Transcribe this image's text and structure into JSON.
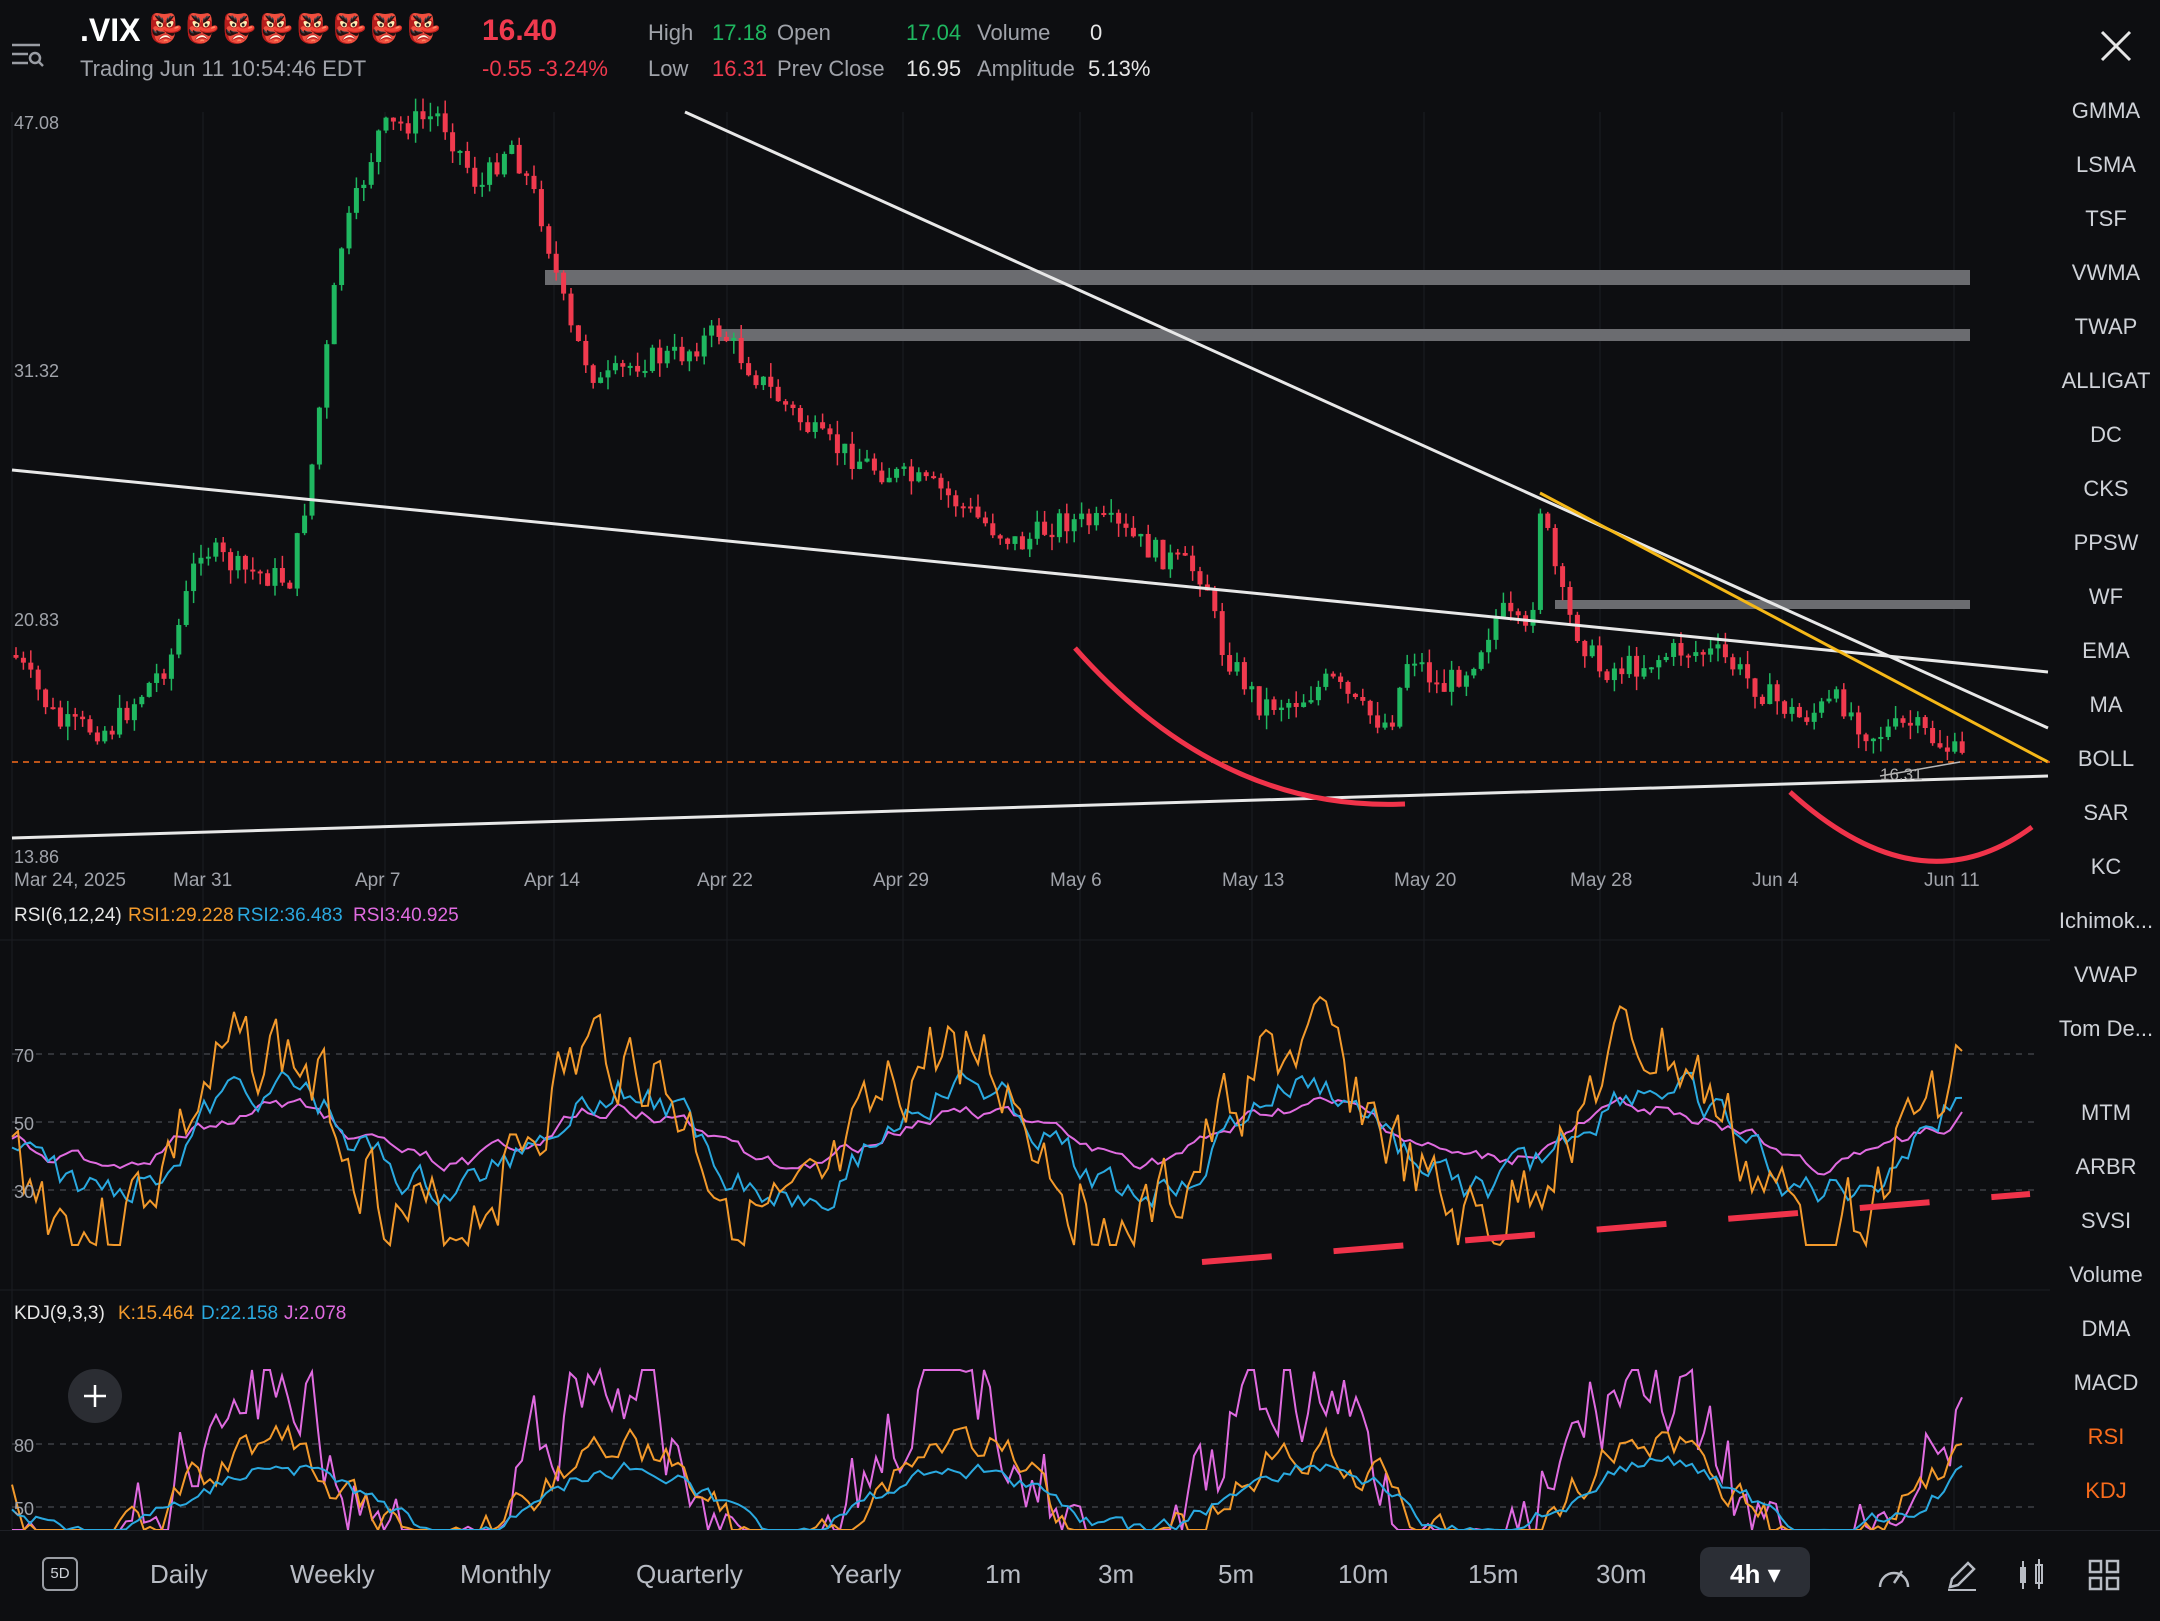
{
  "header": {
    "ticker": ".VIX",
    "emoji": "👺👺👺👺👺👺👺👺",
    "price": "16.40",
    "change": "-0.55 -3.24%",
    "status": "Trading Jun 11 10:54:46 EDT",
    "stats": {
      "high_label": "High",
      "high_value": "17.18",
      "low_label": "Low",
      "low_value": "16.31",
      "open_label": "Open",
      "open_value": "17.04",
      "prev_close_label": "Prev Close",
      "prev_close_value": "16.95",
      "volume_label": "Volume",
      "volume_value": "0",
      "amplitude_label": "Amplitude",
      "amplitude_value": "5.13%"
    }
  },
  "main_chart": {
    "y_labels": [
      "47.08",
      "31.32",
      "20.83",
      "13.86"
    ],
    "x_labels": [
      "Mar 24, 2025",
      "Mar 31",
      "Apr 7",
      "Apr 14",
      "Apr 22",
      "Apr 29",
      "May 6",
      "May 13",
      "May 20",
      "May 28",
      "Jun 4",
      "Jun 11"
    ],
    "last_low_label": "16.31"
  },
  "rsi_panel": {
    "title": "RSI(6,12,24)",
    "rsi1": "RSI1:29.228",
    "rsi2": "RSI2:36.483",
    "rsi3": "RSI3:40.925",
    "levels": [
      "70",
      "50",
      "30"
    ]
  },
  "kdj_panel": {
    "title": "KDJ(9,3,3)",
    "k": "K:15.464",
    "d": "D:22.158",
    "j": "J:2.078",
    "levels": [
      "80",
      "50"
    ]
  },
  "sidebar": {
    "items": [
      "GMMA",
      "LSMA",
      "TSF",
      "VWMA",
      "TWAP",
      "ALLIGAT",
      "DC",
      "CKS",
      "PPSW",
      "WF",
      "EMA",
      "MA",
      "BOLL",
      "SAR",
      "KC",
      "Ichimok...",
      "VWAP",
      "Tom De...",
      "MTM",
      "ARBR",
      "SVSI",
      "Volume",
      "DMA",
      "MACD",
      "RSI",
      "KDJ"
    ],
    "active": [
      "RSI",
      "KDJ"
    ]
  },
  "timeframes": {
    "badge": "5D",
    "items": [
      "Daily",
      "Weekly",
      "Monthly",
      "Quarterly",
      "Yearly",
      "1m",
      "3m",
      "5m",
      "10m",
      "15m",
      "30m",
      "4h"
    ],
    "active": "4h"
  },
  "colors": {
    "up": "#1fb760",
    "down": "#f03a4e",
    "rsi1": "#f39a2c",
    "rsi2": "#2aa9e0",
    "rsi3": "#e06be0",
    "accent": "#f76b1c"
  }
}
